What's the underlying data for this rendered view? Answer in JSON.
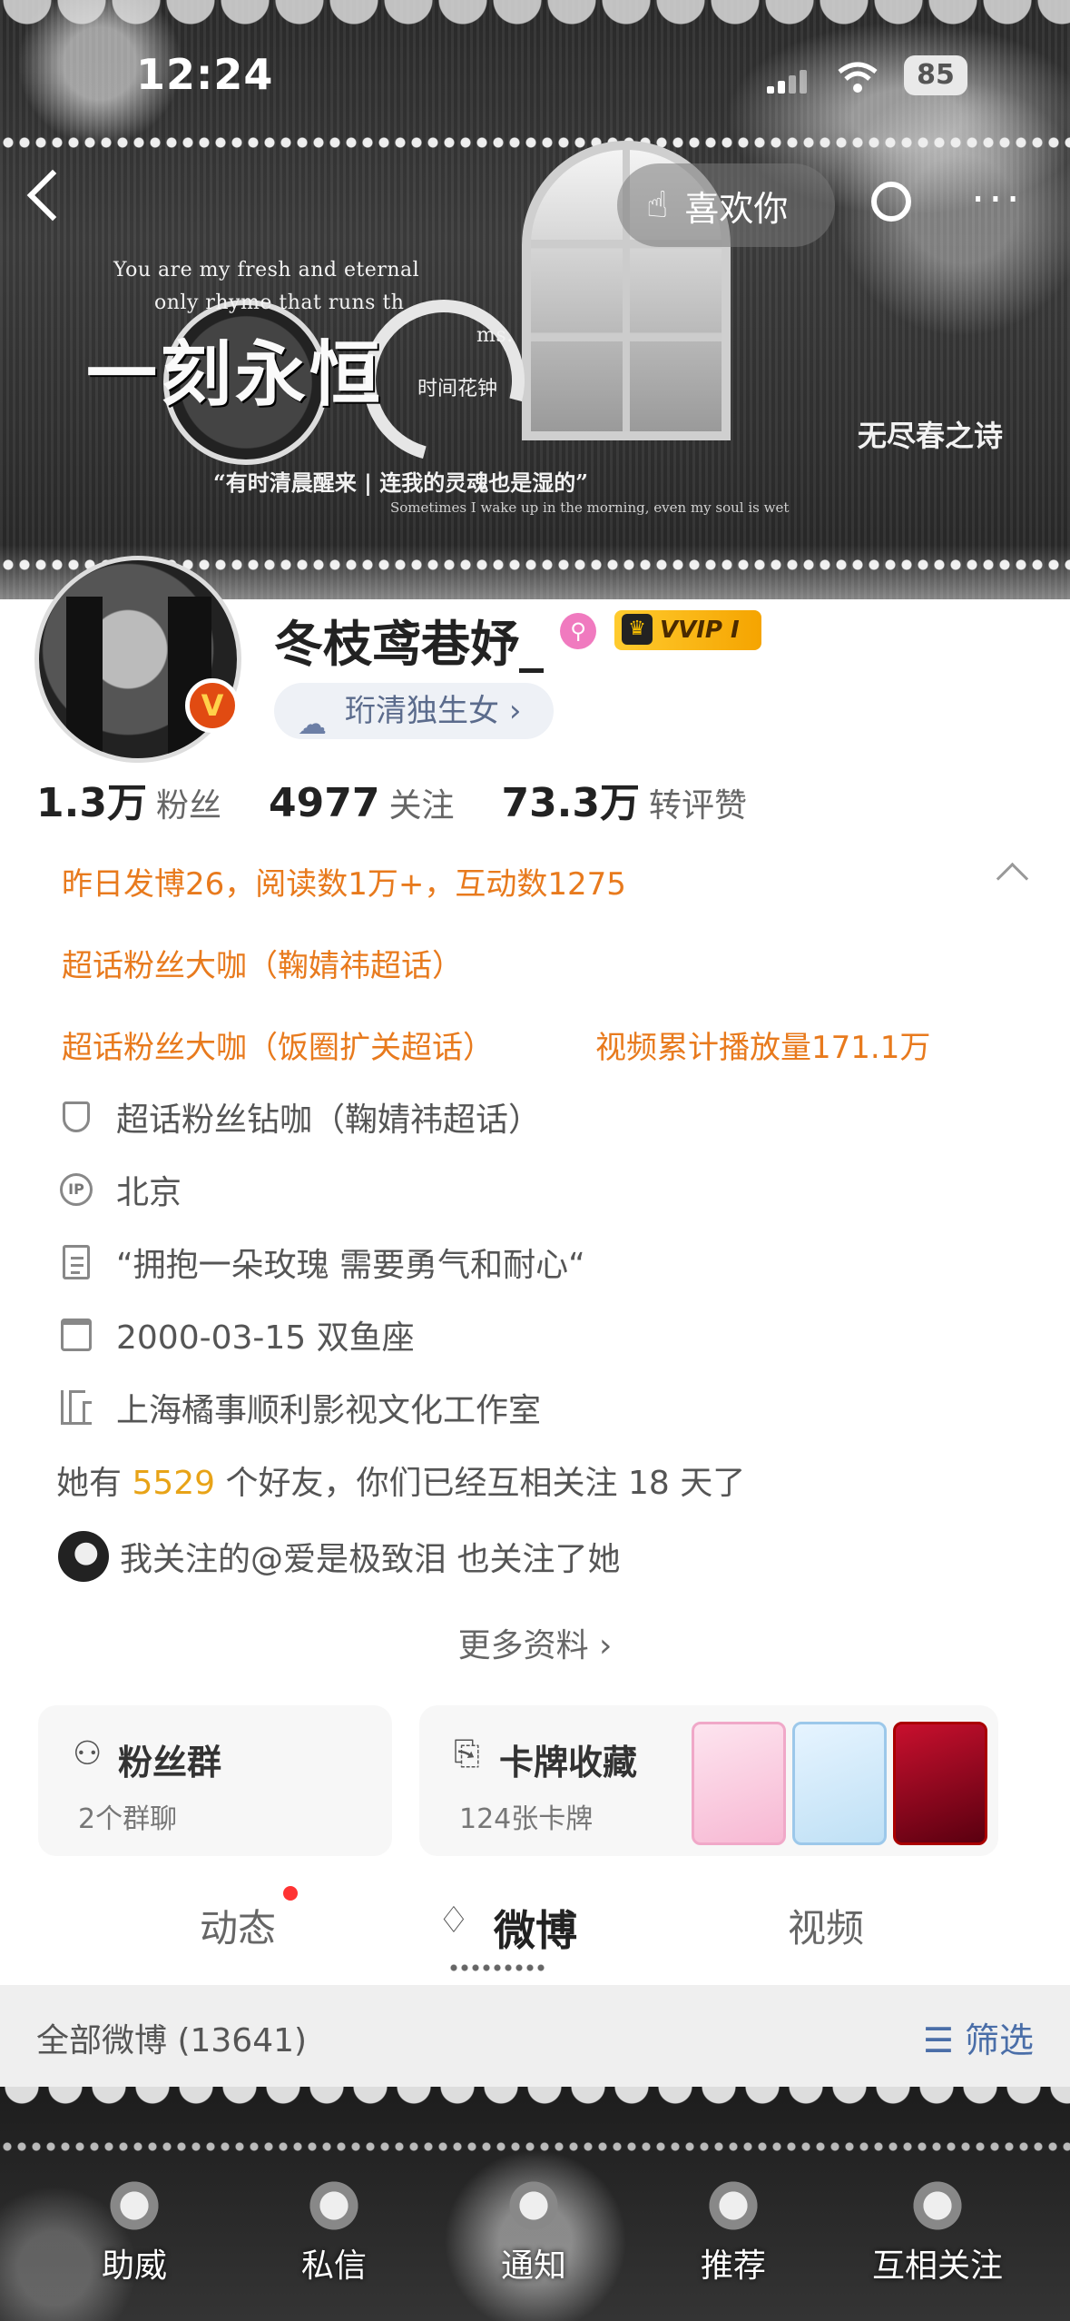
{
  "status_bar": {
    "time": "12:24",
    "battery": "85"
  },
  "banner": {
    "en_line1": "You are my fresh and eternal",
    "en_line2": "only rhyme that runs th",
    "en_line3": "ms.",
    "big_title": "一刻永恒",
    "sub_title": "时间花钟",
    "quote": "“有时清晨醒来 | 连我的灵魂也是湿的”",
    "quote_small": "Sometimes I wake up in the morning, even my soul is wet",
    "poem": "无尽春之诗"
  },
  "nav": {
    "like_label": "喜欢你"
  },
  "profile": {
    "username": "冬枝鸢巷妤_",
    "vip_label": "VVIP Ⅰ",
    "title_pill": "珩清独生女",
    "verified_mark": "V"
  },
  "stats": [
    {
      "value": "1.3万",
      "label": "粉丝"
    },
    {
      "value": "4977",
      "label": "关注"
    },
    {
      "value": "73.3万",
      "label": "转评赞"
    }
  ],
  "highlights": {
    "line1": "昨日发博26，阅读数1万+，互动数1275",
    "line2": "超话粉丝大咖（鞠婧祎超话）",
    "line3a": "超话粉丝大咖（饭圈扩关超话）",
    "line3b": "视频累计播放量171.1万"
  },
  "info": {
    "badge": "超话粉丝钻咖（鞠婧祎超话）",
    "ip_location": "北京",
    "bio": "“拥抱一朵玫瑰 需要勇气和耐心“",
    "birthday": "2000-03-15 双鱼座",
    "company": "上海橘事顺利影视文化工作室"
  },
  "friends": {
    "prefix": "她有",
    "count": "5529",
    "suffix": "个好友，你们已经互相关注 18 天了"
  },
  "mutual": {
    "text": "我关注的@爱是极致泪 也关注了她"
  },
  "more_info": "更多资料",
  "cards": {
    "fans_group": {
      "title": "粉丝群",
      "subtitle": "2个群聊"
    },
    "card_collection": {
      "title": "卡牌收藏",
      "subtitle": "124张卡牌"
    }
  },
  "tabs": [
    {
      "label": "动态",
      "active": false
    },
    {
      "label": "微博",
      "active": true
    },
    {
      "label": "视频",
      "active": false
    }
  ],
  "filter": {
    "all_label": "全部微博 (13641)",
    "filter_label": "筛选"
  },
  "bottom_bar": [
    {
      "label": "助威"
    },
    {
      "label": "私信"
    },
    {
      "label": "通知"
    },
    {
      "label": "推荐"
    },
    {
      "label": "互相关注"
    }
  ],
  "colors": {
    "highlight_orange": "#e87a1d",
    "friend_count": "#e8a317",
    "filter_blue": "#4a6ea8",
    "verified_orange": "#e14b12",
    "vip_gold": "#ffcb2e"
  }
}
